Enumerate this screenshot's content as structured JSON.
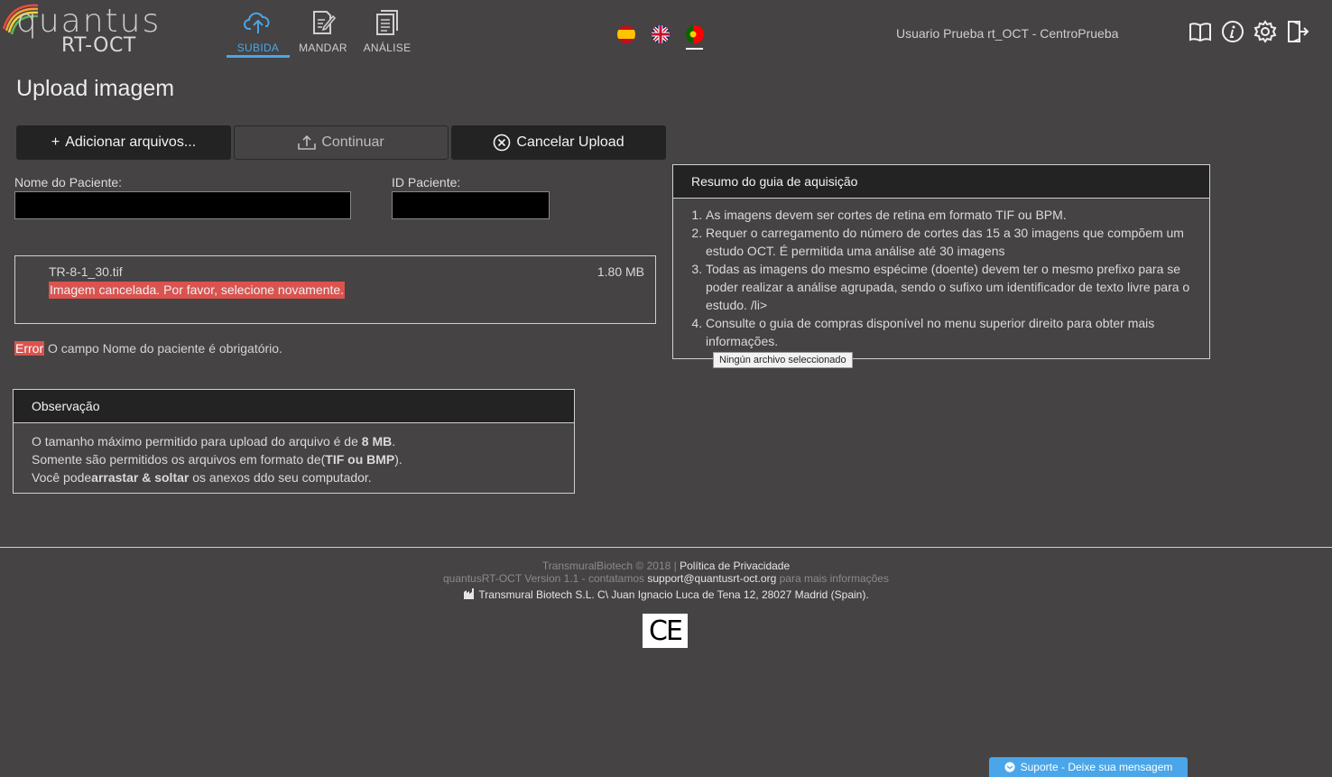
{
  "header": {
    "logo_line1": "quantus",
    "logo_line2": "RT-OCT",
    "nav": [
      {
        "label": "SUBIDA",
        "icon": "cloud-upload-icon",
        "active": true
      },
      {
        "label": "MANDAR",
        "icon": "edit-document-icon",
        "active": false
      },
      {
        "label": "ANÁLISE",
        "icon": "documents-icon",
        "active": false
      }
    ],
    "languages": [
      "es",
      "en",
      "pt"
    ],
    "active_language": "pt",
    "user": "Usuario Prueba rt_OCT - CentroPrueba",
    "icons": [
      "book-icon",
      "info-icon",
      "gear-icon",
      "logout-icon"
    ]
  },
  "page": {
    "title": "Upload imagem"
  },
  "toolbar": {
    "add_label": "Adicionar arquivos...",
    "add_prefix": "+",
    "continue_label": "Continuar",
    "cancel_label": "Cancelar Upload"
  },
  "form": {
    "patient_name_label": "Nome do Paciente:",
    "patient_name_value": "",
    "patient_id_label": "ID Paciente:",
    "patient_id_value": ""
  },
  "file": {
    "name": "TR-8-1_30.tif",
    "size": "1.80 MB",
    "error": "Imagem cancelada. Por favor, selecione novamente."
  },
  "validation": {
    "badge": "Error",
    "message": " O campo Nome do paciente é obrigatório."
  },
  "observacao": {
    "title": "Observação",
    "line1_prefix": "O tamanho máximo permitido para upload do arquivo é de ",
    "line1_bold": "8 MB",
    "line1_suffix": ".",
    "line2_prefix": "Somente são permitidos os arquivos em formato de(",
    "line2_bold": "TIF ou BMP",
    "line2_suffix": ").",
    "line3_prefix": "Você pode",
    "line3_bold": "arrastar & soltar",
    "line3_suffix": " os anexos ddo seu computador."
  },
  "guide": {
    "title": "Resumo do guia de aquisição",
    "items": [
      "As imagens devem ser cortes de retina em formato TIF ou BPM.",
      "Requer o carregamento do número de cortes das 15 a 30 imagens que compõem um estudo OCT. É permitida uma análise até 30 imagens",
      "Todas as imagens do mesmo espécime (doente) devem ter o mesmo prefixo para se poder realizar a análise agrupada, sendo o sufixo um identificador de texto livre para o estudo. /li>",
      "Consulte o guia de compras disponível no menu superior direito para obter mais informações."
    ],
    "tooltip": "Ningún archivo seleccionado"
  },
  "footer": {
    "copyright": "TransmuralBiotech © 2018 | ",
    "privacy_link": "Política de Privacidade",
    "version_prefix": "quantusRT-OCT Version 1.1 - contatamos ",
    "email": "support@quantusrt-oct.org",
    "version_suffix": " para mais informações",
    "address": "Transmural Biotech S.L. C\\ Juan Ignacio Luca de Tena 12, 28027 Madrid (Spain).",
    "ce_mark": "CE",
    "support_label": "Suporte - Deixe sua mensagem"
  }
}
